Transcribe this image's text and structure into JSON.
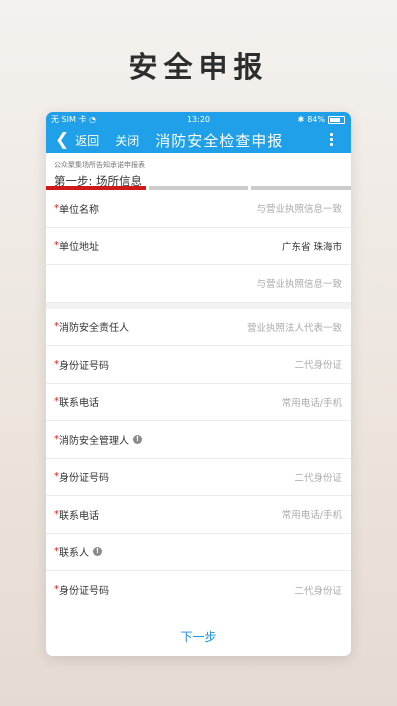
{
  "headline": "安全申报",
  "status_bar": {
    "carrier": "无 SIM 卡",
    "time": "13:20",
    "battery": "84%"
  },
  "nav": {
    "back_label": "返回",
    "close_label": "关闭",
    "title": "消防安全检查申报"
  },
  "form": {
    "subtitle": "公众聚集场所告知承诺申报表",
    "step": "第一步: 场所信息",
    "steps_total": 4,
    "steps_active": 1
  },
  "fields": {
    "unit_name": {
      "label": "单位名称",
      "value": "与营业执照信息一致"
    },
    "unit_address": {
      "label": "单位地址",
      "value": "广东省 珠海市"
    },
    "unit_address_detail": {
      "value": "与营业执照信息一致"
    },
    "fire_responsible": {
      "label": "消防安全责任人",
      "value": "营业执照法人代表一致"
    },
    "id_number_1": {
      "label": "身份证号码",
      "value": "二代身份证"
    },
    "phone_1": {
      "label": "联系电话",
      "value": "常用电话/手机"
    },
    "fire_manager": {
      "label": "消防安全管理人"
    },
    "id_number_2": {
      "label": "身份证号码",
      "value": "二代身份证"
    },
    "phone_2": {
      "label": "联系电话",
      "value": "常用电话/手机"
    },
    "contact": {
      "label": "联系人"
    },
    "id_number_3": {
      "label": "身份证号码",
      "value": "二代身份证"
    }
  },
  "required_mark": "*",
  "next_button": "下一步",
  "colors": {
    "primary": "#1fa0e8",
    "required": "#d02020",
    "progress_active": "#cf1a1a",
    "link": "#1a8fe3"
  },
  "icons": [
    "wifi-icon",
    "bluetooth-icon",
    "battery-icon",
    "back-chevron-icon",
    "more-vertical-icon",
    "info-icon"
  ]
}
